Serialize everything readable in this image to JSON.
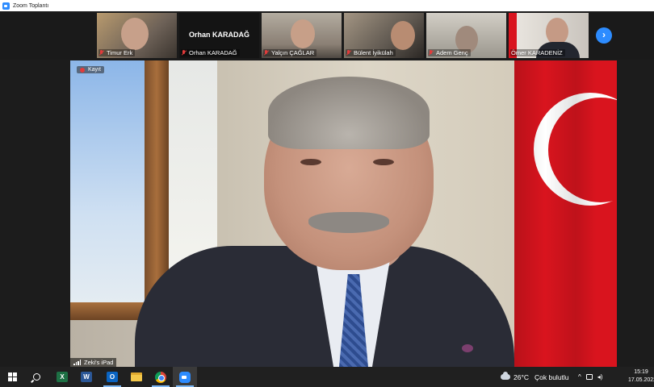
{
  "window": {
    "title": "Zoom Toplantı"
  },
  "participants": [
    {
      "name": "Timur Erk",
      "bg": "#6e6258"
    },
    {
      "name": "Orhan KARADAĞ",
      "display_name": "Orhan KARADAĞ",
      "video_off": true
    },
    {
      "name": "Yalçın ÇAĞLAR",
      "bg": "#8a7f74"
    },
    {
      "name": "Bülent İyikülah",
      "bg": "#5f5850"
    },
    {
      "name": "Adem Genç",
      "bg": "#9b978e"
    },
    {
      "name": "Ömer KARADENİZ",
      "bg": "#c9c4bd"
    }
  ],
  "main_video": {
    "recording_label": "Kayıt",
    "device_label": "Zeki's iPad"
  },
  "taskbar": {
    "apps": [
      "start-icon",
      "search-icon",
      "excel-icon",
      "word-icon",
      "outlook-icon",
      "file-explorer-icon",
      "chrome-icon",
      "zoom-icon"
    ],
    "excel_letter": "X",
    "word_letter": "W",
    "outlook_letter": "O",
    "weather_temp": "26°C",
    "weather_condition": "Çok bulutlu",
    "tray_chevron": "^",
    "time": "15:19",
    "date": "17.05.2022"
  },
  "colors": {
    "zoom_blue": "#2d8cff",
    "mute_red": "#e23b3b",
    "flag_red": "#d9141e",
    "taskbar": "#202020"
  }
}
